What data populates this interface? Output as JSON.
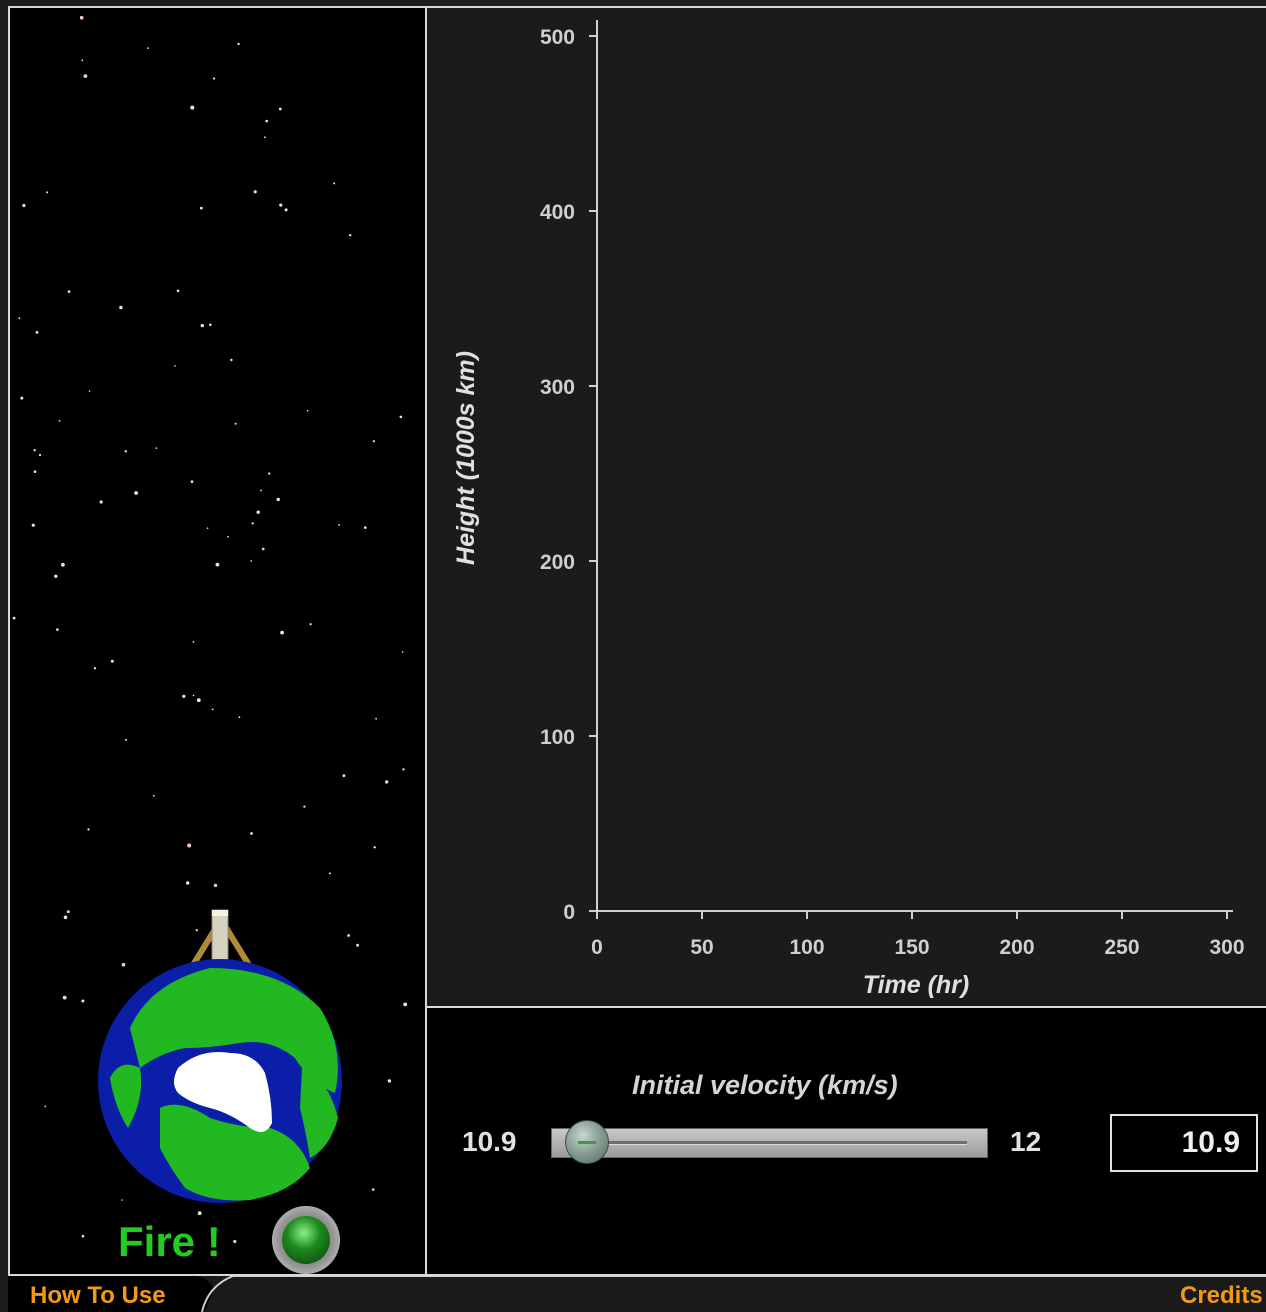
{
  "controls": {
    "fire_label": "Fire !",
    "velocity_label": "Initial velocity (km/s)",
    "velocity_min": "10.9",
    "velocity_max": "12",
    "velocity_value": "10.9",
    "velocity_position": 0.0
  },
  "footer": {
    "how_to_use": "How To Use",
    "credits": "Credits"
  },
  "colors": {
    "accent": "#f29a18",
    "fire_green": "#22cc22",
    "earth_ocean": "#0a1ea8",
    "earth_land": "#22b822",
    "ice": "#ffffff"
  },
  "chart_data": {
    "type": "line",
    "xlabel": "Time (hr)",
    "ylabel": "Height (1000s km)",
    "xlim": [
      0,
      300
    ],
    "ylim": [
      0,
      500
    ],
    "xticks": [
      0,
      50,
      100,
      150,
      200,
      250,
      300
    ],
    "yticks": [
      0,
      100,
      200,
      300,
      400,
      500
    ],
    "series": []
  }
}
